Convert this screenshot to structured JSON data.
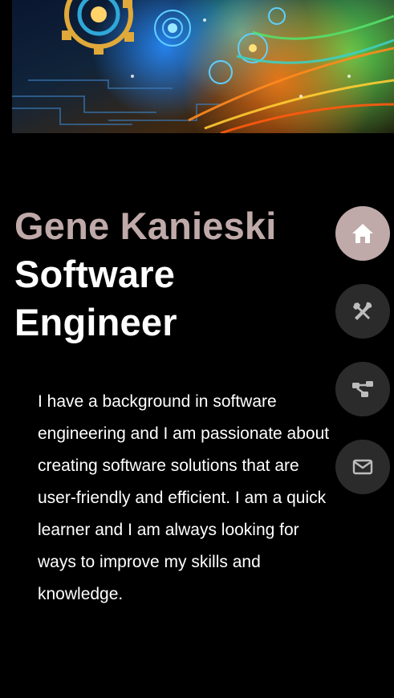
{
  "profile": {
    "name": "Gene Kanieski",
    "role_line1": "Software",
    "role_line2": "Engineer",
    "bio": "I have a background in software engineering and I am passionate about creating software solutions that are user-friendly and efficient. I am a quick learner and I am always looking for ways to improve my skills and knowledge."
  },
  "nav": {
    "items": [
      {
        "icon": "home-icon",
        "active": true
      },
      {
        "icon": "tools-icon",
        "active": false
      },
      {
        "icon": "network-icon",
        "active": false
      },
      {
        "icon": "envelope-icon",
        "active": false
      }
    ]
  },
  "colors": {
    "background": "#000000",
    "accent": "#bfaaa9",
    "nav_inactive": "#2b2b2b",
    "text": "#ffffff"
  }
}
